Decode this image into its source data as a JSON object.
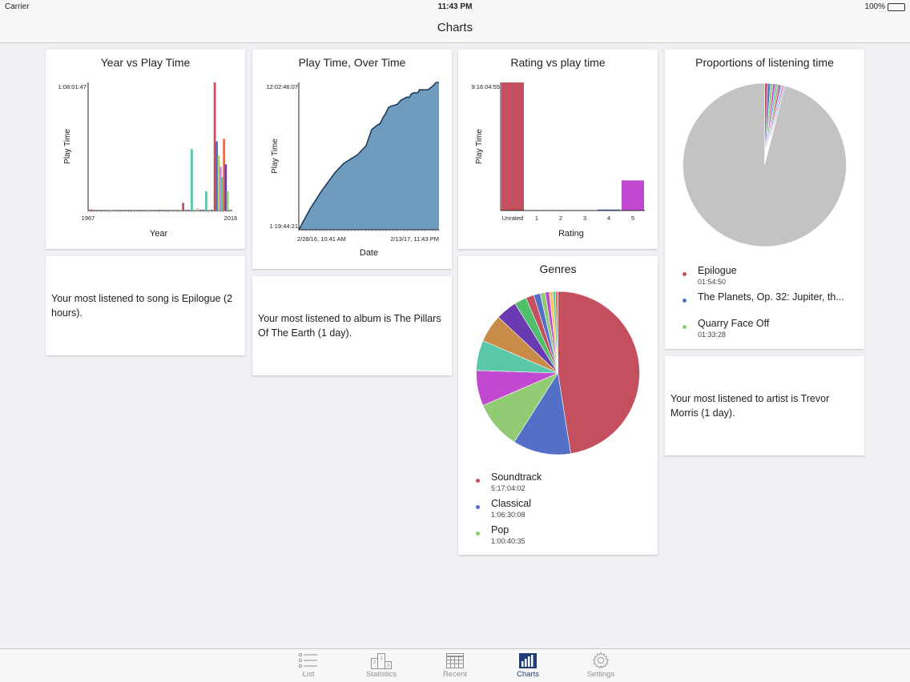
{
  "status_bar": {
    "carrier": "Carrier",
    "time": "11:43 PM",
    "battery": "100%"
  },
  "nav": {
    "title": "Charts"
  },
  "cards": {
    "year_vs_playtime": {
      "title": "Year vs Play Time"
    },
    "playtime_over_time": {
      "title": "Play Time, Over Time"
    },
    "rating_vs_playtime": {
      "title": "Rating vs play time"
    },
    "proportions": {
      "title": "Proportions of listening time"
    },
    "genres": {
      "title": "Genres"
    }
  },
  "chart_data": [
    {
      "type": "bar",
      "title": "Year vs Play Time",
      "xlabel": "Year",
      "ylabel": "Play Time",
      "y_top_label": "1:08:01:47",
      "x_tick_labels": [
        "1967",
        "2016"
      ],
      "xlim": [
        1967,
        2016
      ],
      "ylim": [
        0,
        100
      ],
      "series_colors": [
        "#c4505f",
        "#5470c6",
        "#91cc75",
        "#fac858",
        "#e3704b",
        "#6a3ab0",
        "#5ac8a8",
        "#c58ad0"
      ],
      "bars": [
        {
          "x": 1968,
          "value": 0.8,
          "color": "#c4505f"
        },
        {
          "x": 1971,
          "value": 0.5,
          "color": "#5470c6"
        },
        {
          "x": 1975,
          "value": 0.4,
          "color": "#91cc75"
        },
        {
          "x": 1979,
          "value": 0.5,
          "color": "#5470c6"
        },
        {
          "x": 1983,
          "value": 0.4,
          "color": "#c4505f"
        },
        {
          "x": 1988,
          "value": 0.5,
          "color": "#91cc75"
        },
        {
          "x": 1992,
          "value": 0.6,
          "color": "#5470c6"
        },
        {
          "x": 1996,
          "value": 0.4,
          "color": "#c4505f"
        },
        {
          "x": 1999,
          "value": 0.5,
          "color": "#91cc75"
        },
        {
          "x": 2000,
          "value": 6,
          "color": "#c4505f"
        },
        {
          "x": 2002,
          "value": 0.6,
          "color": "#5470c6"
        },
        {
          "x": 2003,
          "value": 48,
          "color": "#5ac8a8"
        },
        {
          "x": 2004,
          "value": 0.8,
          "color": "#91cc75"
        },
        {
          "x": 2005,
          "value": 2,
          "color": "#c8c8c8"
        },
        {
          "x": 2006,
          "value": 0.6,
          "color": "#c4505f"
        },
        {
          "x": 2007,
          "value": 0.7,
          "color": "#5470c6"
        },
        {
          "x": 2008,
          "value": 15,
          "color": "#5ac8a8"
        },
        {
          "x": 2009,
          "value": 0.7,
          "color": "#91cc75"
        },
        {
          "x": 2010,
          "value": 0.6,
          "color": "#5470c6"
        },
        {
          "x": 2011,
          "value": 100,
          "color": "#c4505f"
        },
        {
          "x": 2011.7,
          "value": 54,
          "color": "#5470c6"
        },
        {
          "x": 2012.4,
          "value": 43,
          "color": "#b6d36a"
        },
        {
          "x": 2013,
          "value": 34,
          "color": "#c58ad0"
        },
        {
          "x": 2013.6,
          "value": 26,
          "color": "#5ac8a8"
        },
        {
          "x": 2014.2,
          "value": 56,
          "color": "#e3704b"
        },
        {
          "x": 2014.8,
          "value": 36,
          "color": "#6a3ab0"
        },
        {
          "x": 2015.4,
          "value": 15,
          "color": "#91cc75"
        }
      ]
    },
    {
      "type": "area",
      "title": "Play Time, Over Time",
      "xlabel": "Date",
      "ylabel": "Play Time",
      "x_tick_labels": [
        "2/28/16, 10:41 AM",
        "2/13/17, 11:43 PM"
      ],
      "y_tick_labels": [
        "1:19:44:21",
        "12:02:46:07"
      ],
      "xlim": [
        0,
        100
      ],
      "ylim": [
        0,
        100
      ],
      "color": "#6f9bbf",
      "line_color": "#1d3c5c",
      "points": [
        [
          0,
          0
        ],
        [
          8,
          14
        ],
        [
          16,
          26
        ],
        [
          26,
          39
        ],
        [
          32,
          45
        ],
        [
          42,
          51
        ],
        [
          48,
          57
        ],
        [
          52,
          68
        ],
        [
          56,
          71
        ],
        [
          58,
          72
        ],
        [
          60,
          76
        ],
        [
          62,
          79
        ],
        [
          64,
          83
        ],
        [
          66,
          84
        ],
        [
          70,
          85
        ],
        [
          73,
          88
        ],
        [
          75,
          89
        ],
        [
          77,
          90
        ],
        [
          79,
          90
        ],
        [
          80,
          92
        ],
        [
          82,
          93
        ],
        [
          85,
          93
        ],
        [
          86,
          95
        ],
        [
          88,
          95
        ],
        [
          92,
          95
        ],
        [
          95,
          97
        ],
        [
          97,
          99
        ],
        [
          98,
          100
        ],
        [
          100,
          100
        ]
      ]
    },
    {
      "type": "bar",
      "title": "Rating vs play time",
      "xlabel": "Rating",
      "ylabel": "Play Time",
      "y_top_label": "9:16:04:55",
      "categories": [
        "Unrated",
        "1",
        "2",
        "3",
        "4",
        "5"
      ],
      "values": [
        100,
        0.3,
        0.2,
        0.2,
        0.8,
        23.5
      ],
      "colors": [
        "#c4505f",
        "#5470c6",
        "#91cc75",
        "#fac858",
        "#5470c6",
        "#c149cf"
      ],
      "ylim": [
        0,
        100
      ]
    },
    {
      "type": "pie",
      "title": "Proportions of listening time",
      "slices": [
        {
          "value": 0.6,
          "color": "#c4505f"
        },
        {
          "value": 0.55,
          "color": "#5470c6"
        },
        {
          "value": 0.5,
          "color": "#91cc75"
        },
        {
          "value": 0.45,
          "color": "#c149cf"
        },
        {
          "value": 0.4,
          "color": "#5ac8a8"
        },
        {
          "value": 0.35,
          "color": "#c98b48"
        },
        {
          "value": 0.33,
          "color": "#6a3ab0"
        },
        {
          "value": 0.3,
          "color": "#8fb8d8"
        },
        {
          "value": 0.28,
          "color": "#e36b8a"
        },
        {
          "value": 0.26,
          "color": "#7fb4e8"
        },
        {
          "value": 96.0,
          "color": "#c3c3c3"
        }
      ],
      "legend": [
        {
          "name": "Epilogue",
          "value": "01:54:50",
          "color": "#c4505f"
        },
        {
          "name": "The Planets, Op. 32: Jupiter, th...",
          "value": "",
          "color": "#5470c6"
        },
        {
          "name": "Quarry Face Off",
          "value": "01:33:28",
          "color": "#91cc75"
        }
      ]
    },
    {
      "type": "pie",
      "title": "Genres",
      "slices": [
        {
          "value": 47.5,
          "color": "#c4505f"
        },
        {
          "value": 11.5,
          "color": "#5470c6"
        },
        {
          "value": 9.5,
          "color": "#91cc75"
        },
        {
          "value": 7.0,
          "color": "#c149cf"
        },
        {
          "value": 6.0,
          "color": "#5ac8a8"
        },
        {
          "value": 5.5,
          "color": "#c98b48"
        },
        {
          "value": 4.2,
          "color": "#6a3ab0"
        },
        {
          "value": 2.4,
          "color": "#4fbf6a"
        },
        {
          "value": 1.6,
          "color": "#c4505f"
        },
        {
          "value": 1.3,
          "color": "#5470c6"
        },
        {
          "value": 1.0,
          "color": "#91cc75"
        },
        {
          "value": 0.8,
          "color": "#c149cf"
        },
        {
          "value": 0.7,
          "color": "#fac858"
        },
        {
          "value": 0.5,
          "color": "#5ac8a8"
        },
        {
          "value": 0.5,
          "color": "#e3704b"
        }
      ],
      "legend": [
        {
          "name": "Soundtrack",
          "value": "5:17:04:02",
          "color": "#c4505f"
        },
        {
          "name": "Classical",
          "value": "1:06:30:08",
          "color": "#5470c6"
        },
        {
          "name": "Pop",
          "value": "1:00:40:35",
          "color": "#91cc75"
        }
      ]
    }
  ],
  "insights": {
    "song": "Your most listened to song is Epilogue (2 hours).",
    "album": "Your most listened to album is The Pillars Of The Earth (1 day).",
    "artist": "Your most listened to artist is Trevor Morris (1 day)."
  },
  "tabs": [
    {
      "label": "List",
      "icon": "list-icon",
      "active": false
    },
    {
      "label": "Statistics",
      "icon": "podium-icon",
      "active": false
    },
    {
      "label": "Recent",
      "icon": "calendar-grid-icon",
      "active": false
    },
    {
      "label": "Charts",
      "icon": "bar-chart-icon",
      "active": true
    },
    {
      "label": "Settings",
      "icon": "gear-icon",
      "active": false
    }
  ]
}
